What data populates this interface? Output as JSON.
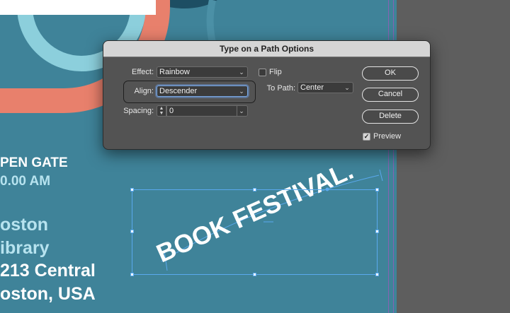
{
  "poster": {
    "lines": [
      {
        "text": "PEN GATE",
        "style": "white"
      },
      {
        "text": "0.00 AM",
        "style": "light"
      },
      {
        "text": "oston",
        "style": "light"
      },
      {
        "text": "ibrary",
        "style": "light"
      },
      {
        "text": "213 Central",
        "style": "white"
      },
      {
        "text": "oston, USA",
        "style": "white"
      }
    ],
    "path_text": "BOOK FESTIVAL.",
    "colors": {
      "teal": "#3f8399",
      "salmon": "#e8806c",
      "light_teal": "#8ccfdc",
      "dark_navy": "#1d4e63"
    }
  },
  "dialog": {
    "title": "Type on a Path Options",
    "effect": {
      "label": "Effect:",
      "value": "Rainbow"
    },
    "align": {
      "label": "Align:",
      "value": "Descender"
    },
    "spacing": {
      "label": "Spacing:",
      "value": "0"
    },
    "flip": {
      "label": "Flip",
      "checked": false
    },
    "to_path": {
      "label": "To Path:",
      "value": "Center"
    },
    "buttons": {
      "ok": "OK",
      "cancel": "Cancel",
      "delete": "Delete"
    },
    "preview": {
      "label": "Preview",
      "checked": true
    },
    "icons": {
      "dropdown": "chevron-down-icon",
      "stepper": "stepper-icon",
      "check": "checkmark-icon"
    }
  }
}
